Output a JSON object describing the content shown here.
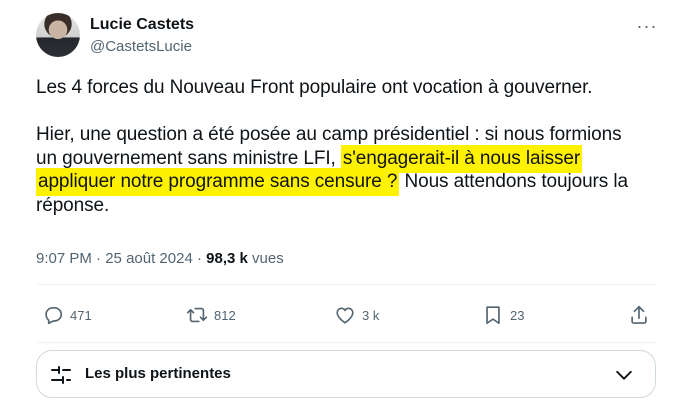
{
  "author": {
    "display_name": "Lucie Castets",
    "handle": "@CastetsLucie",
    "avatar": "avatar-photo"
  },
  "more_menu": {
    "icon": "more-dots-icon",
    "glyph": "···"
  },
  "tweet": {
    "paragraph1": "Les 4 forces du Nouveau Front populaire ont vocation à gouverner.",
    "p2_line1": "Hier, une question a été posée au camp présidentiel : si nous formions",
    "p2_line2_plain": "un gouvernement sans ministre LFI, ",
    "p2_line2_highlight": "s'engagerait-il à nous laisser",
    "p2_line3_highlight": "appliquer notre programme sans censure ?",
    "p2_line3_plain": " Nous attendons toujours la",
    "p2_line4": "réponse."
  },
  "meta": {
    "time": "9:07 PM",
    "separator": "·",
    "date": "25 août 2024",
    "views_count": "98,3 k",
    "views_label": "vues"
  },
  "actions": {
    "reply": {
      "icon": "reply-icon",
      "count": "471"
    },
    "retweet": {
      "icon": "retweet-icon",
      "count": "812"
    },
    "like": {
      "icon": "heart-icon",
      "count": "3 k"
    },
    "bookmark": {
      "icon": "bookmark-icon",
      "count": "23"
    },
    "share": {
      "icon": "share-icon"
    }
  },
  "sort": {
    "label": "Les plus pertinentes",
    "icon": "sliders-icon",
    "chevron": "chevron-down-icon"
  },
  "colors": {
    "highlight": "#fff200",
    "text": "#0f1419",
    "secondary": "#536471",
    "border": "#cfd9de"
  }
}
